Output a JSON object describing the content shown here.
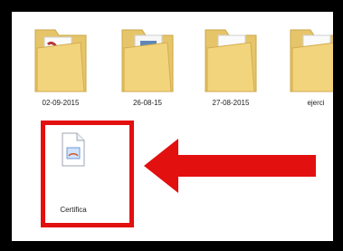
{
  "folders": [
    {
      "label": "02-09-2015",
      "icon": "folder-icon"
    },
    {
      "label": "26-08-15",
      "icon": "folder-icon"
    },
    {
      "label": "27-08-2015",
      "icon": "folder-icon"
    },
    {
      "label": "ejerci",
      "icon": "folder-icon"
    }
  ],
  "file": {
    "label": "Certifica",
    "icon": "java-file-icon"
  },
  "colors": {
    "highlight": "#e31010",
    "arrow": "#e31010"
  }
}
